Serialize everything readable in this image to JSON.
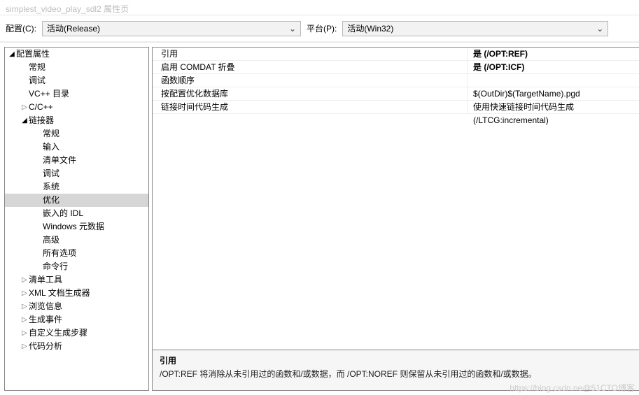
{
  "window": {
    "title": "simplest_video_play_sdl2 属性页"
  },
  "toolbar": {
    "config_label": "配置(C):",
    "config_value": "活动(Release)",
    "platform_label": "平台(P):",
    "platform_value": "活动(Win32)"
  },
  "tree": {
    "root": {
      "label": "配置属性",
      "expanded": true
    },
    "items": [
      {
        "label": "常规",
        "depth": 1,
        "leaf": true
      },
      {
        "label": "调试",
        "depth": 1,
        "leaf": true
      },
      {
        "label": "VC++ 目录",
        "depth": 1,
        "leaf": true
      },
      {
        "label": "C/C++",
        "depth": 1,
        "leaf": false,
        "expanded": false
      },
      {
        "label": "链接器",
        "depth": 1,
        "leaf": false,
        "expanded": true
      },
      {
        "label": "常规",
        "depth": 2,
        "leaf": true
      },
      {
        "label": "输入",
        "depth": 2,
        "leaf": true
      },
      {
        "label": "清单文件",
        "depth": 2,
        "leaf": true
      },
      {
        "label": "调试",
        "depth": 2,
        "leaf": true
      },
      {
        "label": "系统",
        "depth": 2,
        "leaf": true
      },
      {
        "label": "优化",
        "depth": 2,
        "leaf": true,
        "selected": true
      },
      {
        "label": "嵌入的 IDL",
        "depth": 2,
        "leaf": true
      },
      {
        "label": "Windows 元数据",
        "depth": 2,
        "leaf": true
      },
      {
        "label": "高级",
        "depth": 2,
        "leaf": true
      },
      {
        "label": "所有选项",
        "depth": 2,
        "leaf": true
      },
      {
        "label": "命令行",
        "depth": 2,
        "leaf": true
      },
      {
        "label": "清单工具",
        "depth": 1,
        "leaf": false,
        "expanded": false
      },
      {
        "label": "XML 文档生成器",
        "depth": 1,
        "leaf": false,
        "expanded": false
      },
      {
        "label": "浏览信息",
        "depth": 1,
        "leaf": false,
        "expanded": false
      },
      {
        "label": "生成事件",
        "depth": 1,
        "leaf": false,
        "expanded": false
      },
      {
        "label": "自定义生成步骤",
        "depth": 1,
        "leaf": false,
        "expanded": false
      },
      {
        "label": "代码分析",
        "depth": 1,
        "leaf": false,
        "expanded": false
      }
    ]
  },
  "properties": [
    {
      "name": "引用",
      "value": "是 (/OPT:REF)",
      "bold": true
    },
    {
      "name": "启用 COMDAT 折叠",
      "value": "是 (/OPT:ICF)",
      "bold": true
    },
    {
      "name": "函数顺序",
      "value": ""
    },
    {
      "name": "按配置优化数据库",
      "value": "$(OutDir)$(TargetName).pgd"
    },
    {
      "name": "链接时间代码生成",
      "value": "使用快速链接时间代码生成 (/LTCG:incremental)"
    }
  ],
  "description": {
    "title": "引用",
    "text": "/OPT:REF 将消除从未引用过的函数和/或数据，而 /OPT:NOREF 则保留从未引用过的函数和/或数据。"
  },
  "watermark": "https://blog.csdn.ne@51CTO博客"
}
